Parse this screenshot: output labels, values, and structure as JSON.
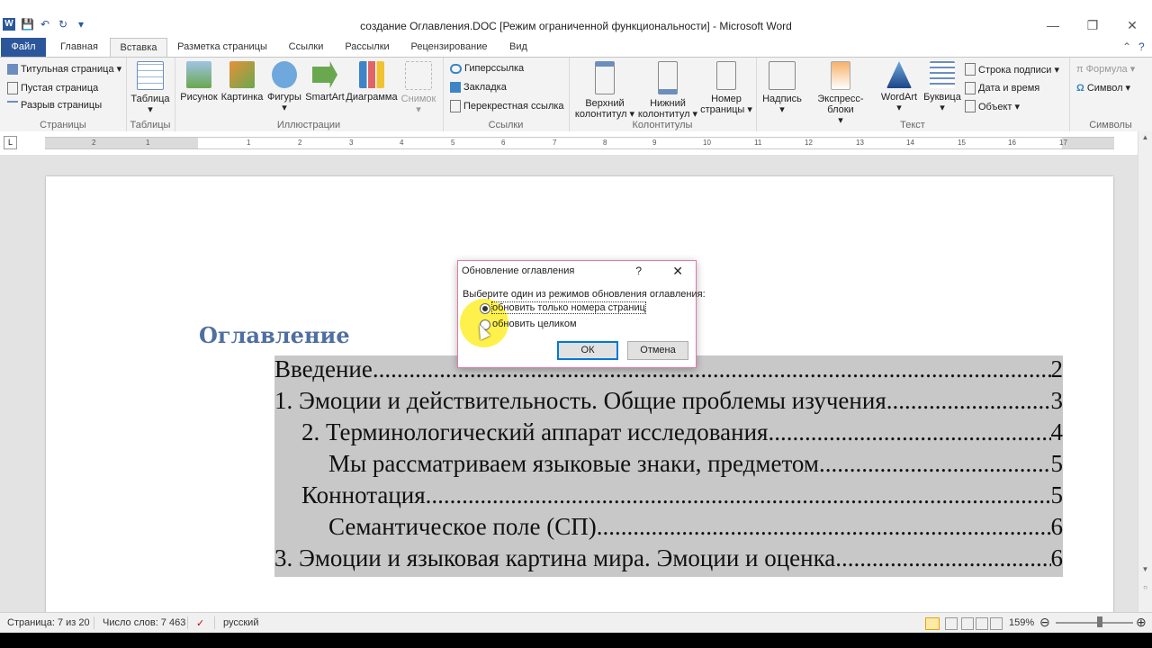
{
  "window": {
    "title": "создание Оглавления.DOC [Режим ограниченной функциональности]  -  Microsoft Word",
    "controls": [
      "—",
      "❐",
      "✕"
    ]
  },
  "qat": {
    "logo": "W",
    "save": "💾",
    "undo": "↶",
    "redo": "↻",
    "more": "▾"
  },
  "tabs": [
    "Файл",
    "Главная",
    "Вставка",
    "Разметка страницы",
    "Ссылки",
    "Рассылки",
    "Рецензирование",
    "Вид"
  ],
  "active_tab": "Вставка",
  "ribbon": {
    "pages": {
      "label": "Страницы",
      "items": [
        "Титульная страница ▾",
        "Пустая страница",
        "Разрыв страницы"
      ]
    },
    "tables": {
      "label": "Таблицы",
      "item": "Таблица"
    },
    "illustrations": {
      "label": "Иллюстрации",
      "items": [
        "Рисунок",
        "Картинка",
        "Фигуры",
        "SmartArt",
        "Диаграмма",
        "Снимок"
      ]
    },
    "links": {
      "label": "Ссылки",
      "items": [
        "Гиперссылка",
        "Закладка",
        "Перекрестная ссылка"
      ]
    },
    "headers": {
      "label": "Колонтитулы",
      "items": [
        "Верхний колонтитул ▾",
        "Нижний колонтитул ▾",
        "Номер страницы ▾"
      ]
    },
    "text": {
      "label": "Текст",
      "items": [
        "Надпись",
        "Экспресс-блоки",
        "WordArt",
        "Буквица"
      ],
      "small": [
        "Строка подписи ▾",
        "Дата и время",
        "Объект ▾"
      ]
    },
    "symbols": {
      "label": "Символы",
      "items": [
        "Формула ▾",
        "Символ ▾"
      ]
    }
  },
  "ruler": {
    "numbers": [
      "2",
      "1",
      "1",
      "2",
      "3",
      "4",
      "5",
      "6",
      "7",
      "8",
      "9",
      "10",
      "11",
      "12",
      "13",
      "14",
      "15",
      "16",
      "17"
    ]
  },
  "document": {
    "toc_heading": "Оглавление",
    "toc": [
      {
        "text": "Введение",
        "page": "2"
      },
      {
        "text": "1. Эмоции и действительность.  Общие проблемы изучения. ",
        "page": "3"
      },
      {
        "text": "2. Терминологический аппарат исследования ",
        "page": "4"
      },
      {
        "text": "Мы рассматриваем языковые знаки, предметом ",
        "page": "5"
      },
      {
        "text": "Коннотация ",
        "page": "5"
      },
      {
        "text": "Семантическое поле (СП)",
        "page": "6"
      },
      {
        "text": "3. Эмоции и языковая картина мира. Эмоции и оценка ",
        "page": "6"
      }
    ]
  },
  "dialog": {
    "title": "Обновление оглавления",
    "help": "?",
    "close": "✕",
    "prompt": "Выберите один из режимов обновления оглавления:",
    "option1": "обновить только номера страниц",
    "option2": "обновить целиком",
    "selected": "option1",
    "ok": "ОК",
    "cancel": "Отмена"
  },
  "status": {
    "page": "Страница: 7 из 20",
    "words": "Число слов: 7 463",
    "lang": "русский",
    "zoom": "159%"
  }
}
